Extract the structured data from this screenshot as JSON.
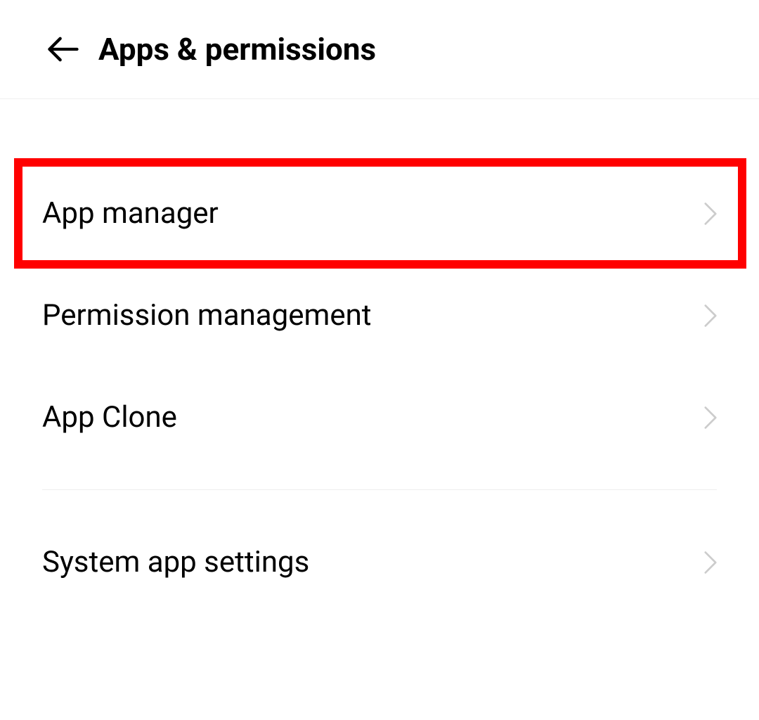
{
  "header": {
    "title": "Apps & permissions"
  },
  "items": [
    {
      "label": "App manager",
      "highlighted": true
    },
    {
      "label": "Permission management",
      "highlighted": false
    },
    {
      "label": "App Clone",
      "highlighted": false
    },
    {
      "label": "System app settings",
      "highlighted": false
    }
  ],
  "colors": {
    "highlight": "#ff0000",
    "chevron": "#cccccc",
    "back_arrow": "#000000"
  }
}
